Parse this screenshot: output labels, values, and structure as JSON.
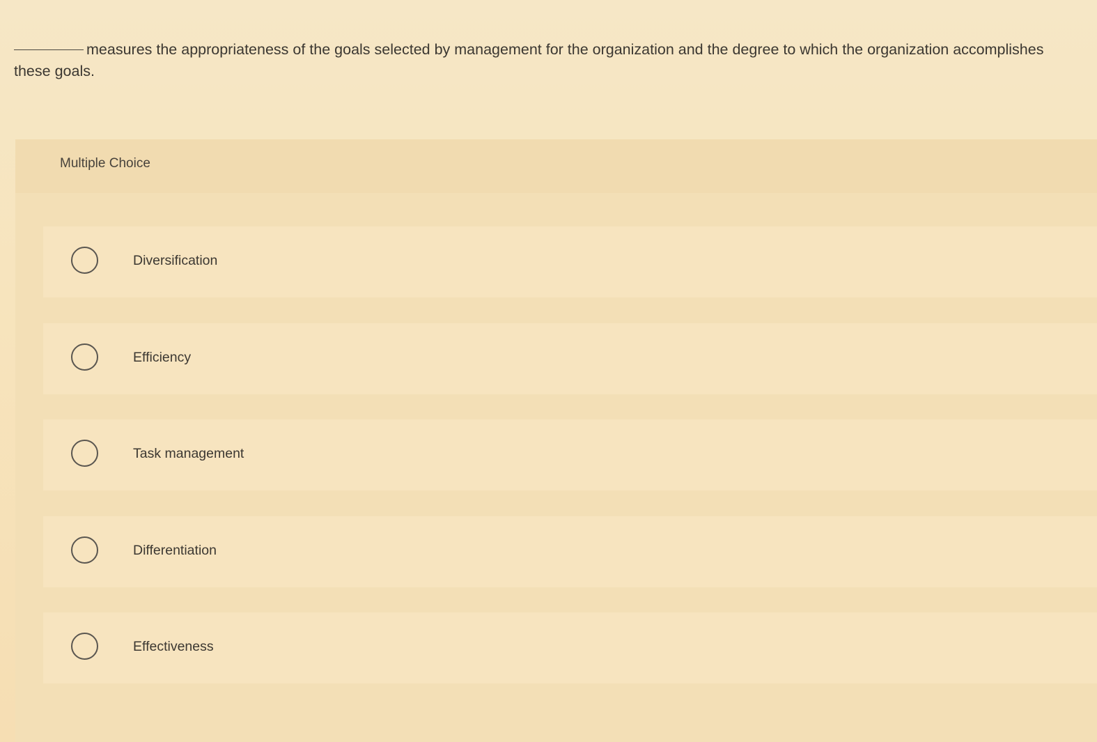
{
  "question": {
    "text": "measures the appropriateness of the goals selected by management for the organization and the degree to which the organization accomplishes these goals."
  },
  "answer_panel": {
    "type_label": "Multiple Choice",
    "choices": [
      {
        "label": "Diversification",
        "selected": false
      },
      {
        "label": "Efficiency",
        "selected": false
      },
      {
        "label": "Task management",
        "selected": false
      },
      {
        "label": "Differentiation",
        "selected": false
      },
      {
        "label": "Effectiveness",
        "selected": false
      }
    ]
  }
}
